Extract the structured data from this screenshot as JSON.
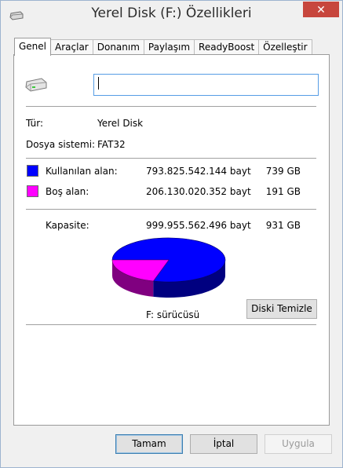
{
  "window": {
    "title": "Yerel Disk (F:) Özellikleri",
    "close_label": "✕"
  },
  "tabs": [
    {
      "label": "Genel",
      "active": true
    },
    {
      "label": "Araçlar",
      "active": false
    },
    {
      "label": "Donanım",
      "active": false
    },
    {
      "label": "Paylaşım",
      "active": false
    },
    {
      "label": "ReadyBoost",
      "active": false
    },
    {
      "label": "Özelleştir",
      "active": false
    }
  ],
  "general": {
    "name_value": "",
    "type_label": "Tür:",
    "type_value": "Yerel Disk",
    "fs_label": "Dosya sistemi:",
    "fs_value": "FAT32",
    "used_label": "Kullanılan alan:",
    "used_bytes": "793.825.542.144 bayt",
    "used_short": "739 GB",
    "used_color": "#0000ff",
    "free_label": "Boş alan:",
    "free_bytes": "206.130.020.352 bayt",
    "free_short": "191 GB",
    "free_color": "#ff00ff",
    "capacity_label": "Kapasite:",
    "capacity_bytes": "999.955.562.496 bayt",
    "capacity_short": "931 GB",
    "drive_label": "F: sürücüsü",
    "cleanup_label": "Diski Temizle",
    "used_fraction": 0.794
  },
  "buttons": {
    "ok": "Tamam",
    "cancel": "İptal",
    "apply": "Uygula"
  },
  "icons": {
    "title": "drive-icon",
    "drive": "hard-drive-icon"
  }
}
